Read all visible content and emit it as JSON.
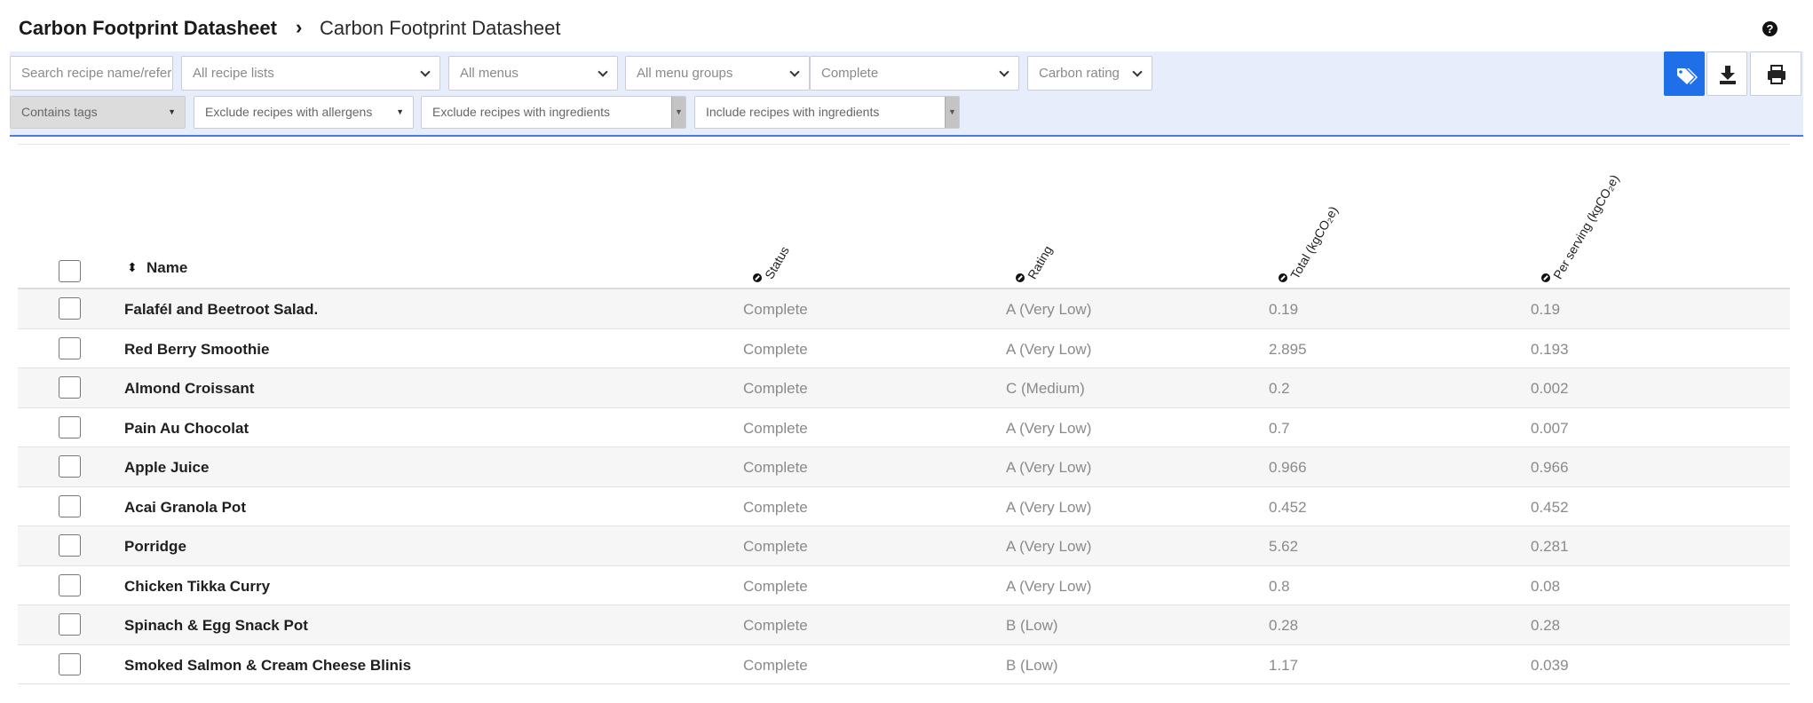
{
  "breadcrumb": {
    "parent": "Carbon Footprint Datasheet",
    "separator": "›",
    "current": "Carbon Footprint Datasheet"
  },
  "help_icon": "question-circle-icon",
  "filters": {
    "search_placeholder": "Search recipe name/reference",
    "recipe_lists": "All recipe lists",
    "menus": "All menus",
    "menu_groups": "All menu groups",
    "status": "Complete",
    "carbon_rating": "Carbon rating",
    "contains_tags": "Contains tags",
    "exclude_allergens": "Exclude recipes with allergens",
    "exclude_ingredients": "Exclude recipes with ingredients",
    "include_ingredients": "Include recipes with ingredients"
  },
  "toolbar": {
    "tag_icon": "tags-icon",
    "download_icon": "download-icon",
    "print_icon": "print-icon",
    "primary_color": "#1f6fe8"
  },
  "table": {
    "headers": {
      "name": "Name",
      "status": "Status",
      "rating": "Rating",
      "total": "Total (kgCO₂e)",
      "per_serving": "Per serving (kgCO₂e)"
    },
    "rows": [
      {
        "name": "Falafél and Beetroot Salad.",
        "status": "Complete",
        "rating": "A (Very Low)",
        "total": "0.19",
        "per_serving": "0.19"
      },
      {
        "name": "Red Berry Smoothie",
        "status": "Complete",
        "rating": "A (Very Low)",
        "total": "2.895",
        "per_serving": "0.193"
      },
      {
        "name": "Almond Croissant",
        "status": "Complete",
        "rating": "C (Medium)",
        "total": "0.2",
        "per_serving": "0.002"
      },
      {
        "name": "Pain Au Chocolat",
        "status": "Complete",
        "rating": "A (Very Low)",
        "total": "0.7",
        "per_serving": "0.007"
      },
      {
        "name": "Apple Juice",
        "status": "Complete",
        "rating": "A (Very Low)",
        "total": "0.966",
        "per_serving": "0.966"
      },
      {
        "name": "Acai Granola Pot",
        "status": "Complete",
        "rating": "A (Very Low)",
        "total": "0.452",
        "per_serving": "0.452"
      },
      {
        "name": "Porridge",
        "status": "Complete",
        "rating": "A (Very Low)",
        "total": "5.62",
        "per_serving": "0.281"
      },
      {
        "name": "Chicken Tikka Curry",
        "status": "Complete",
        "rating": "A (Very Low)",
        "total": "0.8",
        "per_serving": "0.08"
      },
      {
        "name": "Spinach & Egg Snack Pot",
        "status": "Complete",
        "rating": "B (Low)",
        "total": "0.28",
        "per_serving": "0.28"
      },
      {
        "name": "Smoked Salmon & Cream Cheese Blinis",
        "status": "Complete",
        "rating": "B (Low)",
        "total": "1.17",
        "per_serving": "0.039"
      }
    ]
  }
}
